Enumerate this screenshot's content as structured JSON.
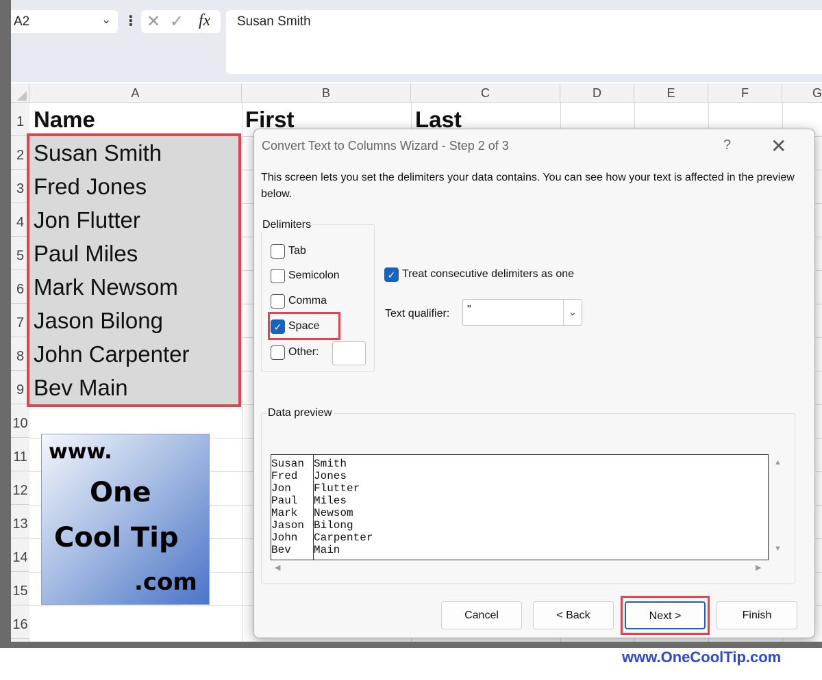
{
  "formula_bar": {
    "name_box": "A2",
    "formula": "Susan Smith"
  },
  "columns": [
    "A",
    "B",
    "C",
    "D",
    "E",
    "F",
    "G"
  ],
  "rows": [
    "1",
    "2",
    "3",
    "4",
    "5",
    "6",
    "7",
    "8",
    "9",
    "10",
    "11",
    "12",
    "13",
    "14",
    "15",
    "16"
  ],
  "sheet": {
    "headers": {
      "a": "Name",
      "b": "First",
      "c": "Last"
    },
    "names": [
      "Susan Smith",
      "Fred Jones",
      "Jon Flutter",
      "Paul Miles",
      "Mark Newsom",
      "Jason Bilong",
      "John Carpenter",
      "Bev Main"
    ]
  },
  "logo": {
    "line1": "www.",
    "line2": "One",
    "line3": "Cool Tip",
    "line4": ".com"
  },
  "dialog": {
    "title": "Convert Text to Columns Wizard - Step 2 of 3",
    "help": "?",
    "instructions": "This screen lets you set the delimiters your data contains.  You can see how your text is affected in the preview below.",
    "delimiters_label": "Delimiters",
    "delimiters": [
      {
        "label": "Tab",
        "checked": false
      },
      {
        "label": "Semicolon",
        "checked": false
      },
      {
        "label": "Comma",
        "checked": false
      },
      {
        "label": "Space",
        "checked": true
      },
      {
        "label": "Other:",
        "checked": false
      }
    ],
    "treat_consecutive": {
      "label": "Treat consecutive delimiters as one",
      "checked": true
    },
    "text_qualifier": {
      "label": "Text qualifier:",
      "value": "\""
    },
    "preview_label": "Data preview",
    "preview_rows": [
      [
        "Susan",
        "Smith"
      ],
      [
        "Fred",
        "Jones"
      ],
      [
        "Jon",
        "Flutter"
      ],
      [
        "Paul",
        "Miles"
      ],
      [
        "Mark",
        "Newsom"
      ],
      [
        "Jason",
        "Bilong"
      ],
      [
        "John",
        "Carpenter"
      ],
      [
        "Bev",
        "Main"
      ]
    ],
    "buttons": {
      "cancel": "Cancel",
      "back": "< Back",
      "next": "Next >",
      "finish": "Finish"
    }
  },
  "watermark": "www.OneCoolTip.com",
  "colors": {
    "highlight_red": "#e0454d",
    "checkbox_blue": "#1565c0",
    "accent_blue": "#1f5fbf",
    "watermark_blue": "#2f49d6"
  }
}
